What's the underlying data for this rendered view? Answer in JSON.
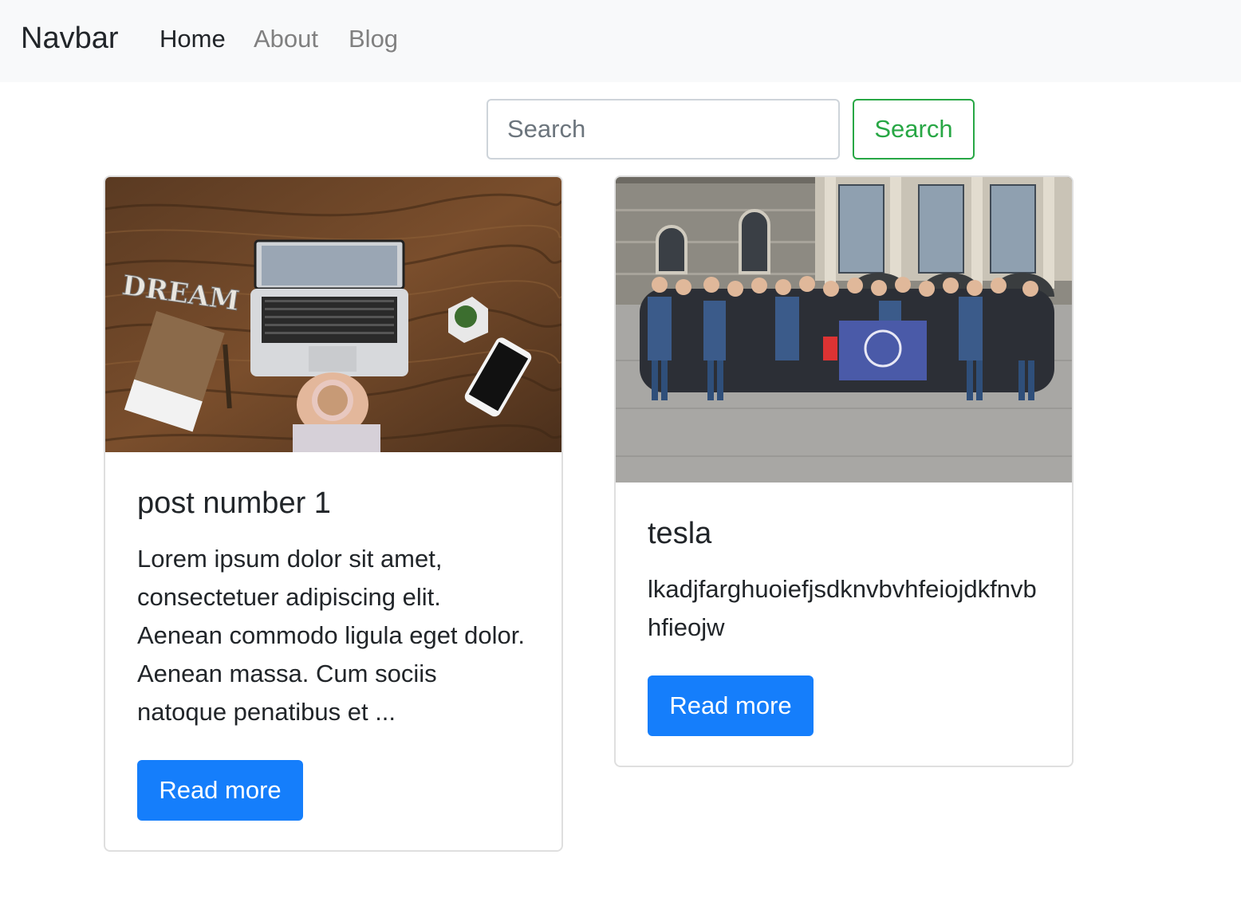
{
  "navbar": {
    "brand": "Navbar",
    "links": [
      {
        "label": "Home"
      },
      {
        "label": "About"
      },
      {
        "label": "Blog"
      }
    ]
  },
  "search": {
    "placeholder": "Search",
    "button_label": "Search"
  },
  "posts": [
    {
      "title": "post number 1",
      "excerpt": "Lorem ipsum dolor sit amet, consectetuer adipiscing elit. Aenean commodo ligula eget dolor. Aenean massa. Cum sociis natoque penatibus et ...",
      "button_label": "Read more",
      "image_text": "DREAM"
    },
    {
      "title": "tesla",
      "excerpt": "lkadjfarghuoiefjsdknvbvhfeiojdkfnvbhfieojw",
      "button_label": "Read more"
    }
  ],
  "colors": {
    "primary": "#157efb",
    "success": "#28a745",
    "navbar_bg": "#f8f9fa"
  }
}
